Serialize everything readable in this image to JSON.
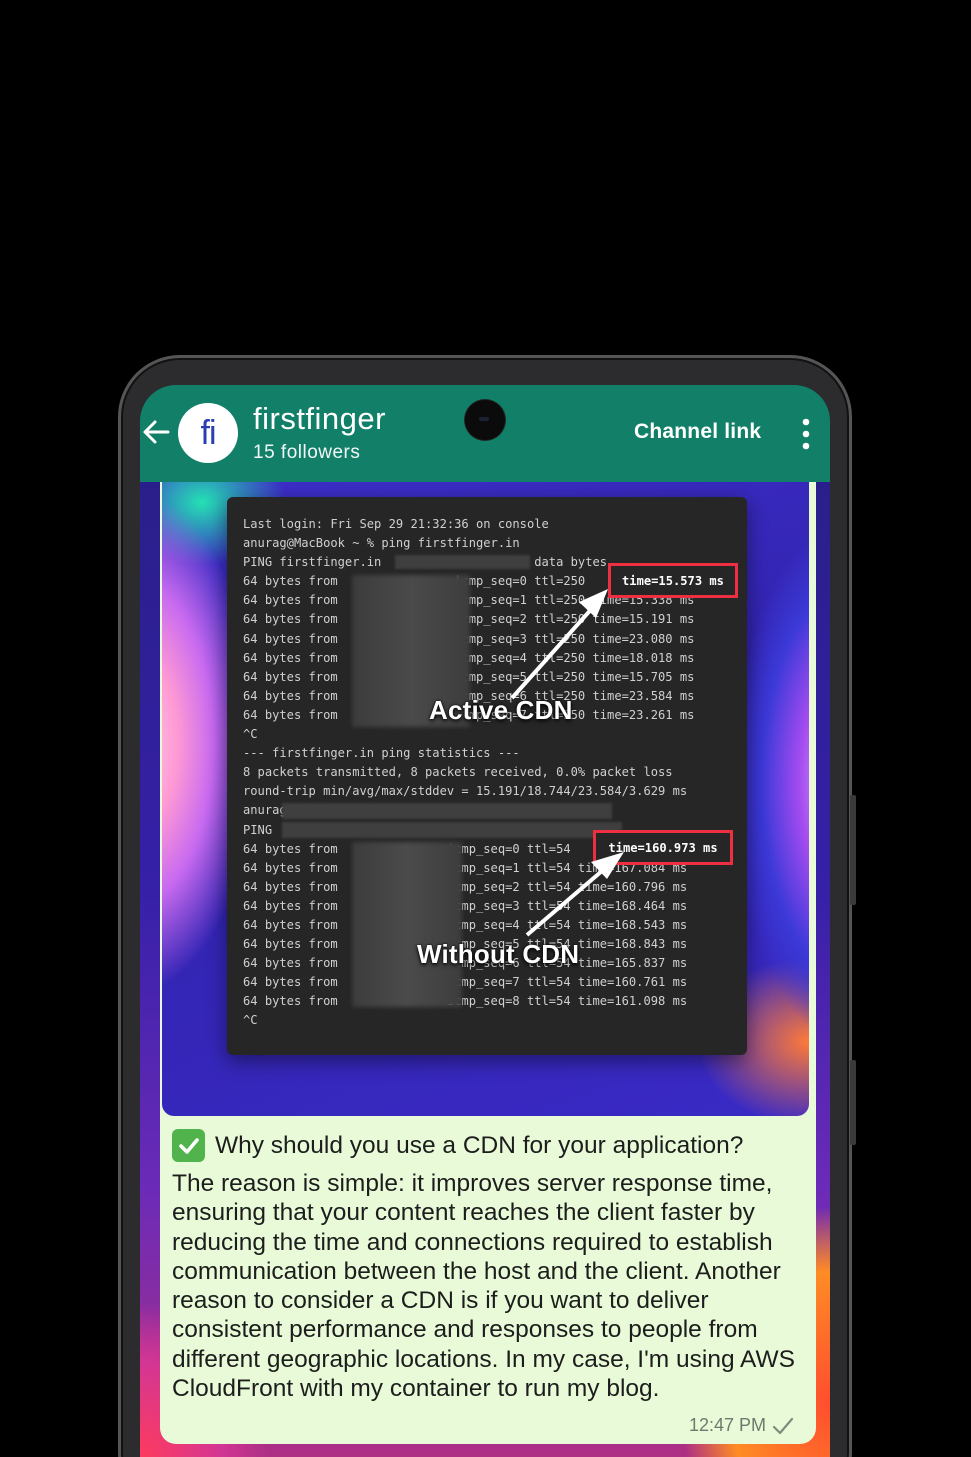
{
  "header": {
    "avatar_text": "fi",
    "channel_name": "firstfinger",
    "followers": "15 followers",
    "channel_link_label": "Channel link"
  },
  "icons": {
    "back": "back-arrow-icon",
    "menu": "more-vertical-icon",
    "check": "check-mark-icon",
    "read": "single-tick-icon"
  },
  "terminal": {
    "lines": [
      "Last login: Fri Sep 29 21:32:36 on console",
      "anurag@MacBook ~ % ping firstfinger.in",
      "PING firstfinger.in                  56 data bytes",
      "64 bytes from                icmp_seq=0 ttl=250",
      "64 bytes from                icmp_seq=1 ttl=250 time=15.338 ms",
      "64 bytes from                icmp_seq=2 ttl=250 time=15.191 ms",
      "64 bytes from                icmp_seq=3 ttl=250 time=23.080 ms",
      "64 bytes from                icmp_seq=4 ttl=250 time=18.018 ms",
      "64 bytes from                icmp_seq=5 ttl=250 time=15.705 ms",
      "64 bytes from                icmp_seq=6 ttl=250 time=23.584 ms",
      "64 bytes from                icmp_seq=7 ttl=250 time=23.261 ms",
      "^C",
      "--- firstfinger.in ping statistics ---",
      "8 packets transmitted, 8 packets received, 0.0% packet loss",
      "round-trip min/avg/max/stddev = 15.191/18.744/23.584/3.629 ms",
      "anurag@MacBook ~ % ping",
      "PING                                  56 data bytes",
      "64 bytes from               icmp_seq=0 ttl=54",
      "64 bytes from               icmp_seq=1 ttl=54 time=167.084 ms",
      "64 bytes from               icmp_seq=2 ttl=54 time=160.796 ms",
      "64 bytes from               icmp_seq=3 ttl=54 time=168.464 ms",
      "64 bytes from               icmp_seq=4 ttl=54 time=168.543 ms",
      "64 bytes from               icmp_seq=5 ttl=54 time=168.843 ms",
      "64 bytes from               icmp_seq=6 ttl=54 time=165.837 ms",
      "64 bytes from               icmp_seq=7 ttl=54 time=160.761 ms",
      "64 bytes from               icmp_seq=8 ttl=54 time=161.098 ms",
      "^C"
    ],
    "highlight_1": "time=15.573 ms",
    "highlight_2": "time=160.973 ms",
    "annotation_1": "Active CDN",
    "annotation_2": "Without CDN"
  },
  "message": {
    "title": "Why should you use a CDN for your application?",
    "body": "The reason is simple: it improves server response time, ensuring that your content reaches the client faster by reducing the time and connections required to establish communication between the host and the client. Another reason to consider a CDN is if you want to deliver consistent performance and responses to people from different geographic locations. In my case, I'm using AWS CloudFront with my container to run my blog.",
    "time": "12:47 PM"
  },
  "colors": {
    "header_bg": "#128068",
    "bubble_bg": "#e8fad7",
    "highlight_border": "#ee2f42",
    "check_bg": "#51b34b"
  }
}
